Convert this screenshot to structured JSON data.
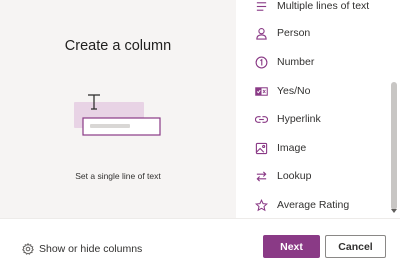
{
  "left_panel": {
    "title": "Create a column",
    "description": "Set a single line of text"
  },
  "column_types": [
    {
      "label": "Multiple lines of text",
      "icon": "multiple-lines-icon"
    },
    {
      "label": "Person",
      "icon": "person-icon"
    },
    {
      "label": "Number",
      "icon": "number-icon"
    },
    {
      "label": "Yes/No",
      "icon": "yes-no-icon"
    },
    {
      "label": "Hyperlink",
      "icon": "hyperlink-icon"
    },
    {
      "label": "Image",
      "icon": "image-icon"
    },
    {
      "label": "Lookup",
      "icon": "lookup-icon"
    },
    {
      "label": "Average Rating",
      "icon": "star-icon"
    }
  ],
  "footer": {
    "show_hide_label": "Show or hide columns",
    "next_label": "Next",
    "cancel_label": "Cancel"
  },
  "colors": {
    "accent": "#8a3a86",
    "left_panel_bg": "#f6f4f3"
  }
}
